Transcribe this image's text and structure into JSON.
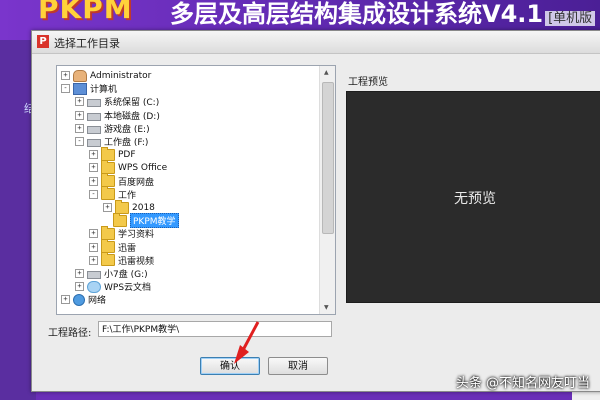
{
  "app": {
    "logo": "PKPM",
    "title": "多层及高层结构集成设计系统V4.1",
    "edition_tag": "[单机版"
  },
  "background": {
    "left_tab_text": "结"
  },
  "dialog": {
    "title": "选择工作目录",
    "preview_label": "工程预览",
    "preview_text": "无预览",
    "path_label": "工程路径:",
    "path_value": "F:\\工作\\PKPM教学\\",
    "ok_label": "确认",
    "cancel_label": "取消"
  },
  "tree": {
    "items": [
      {
        "label": "Administrator",
        "icon": "user-icon",
        "expander": "+"
      },
      {
        "label": "计算机",
        "icon": "computer-icon",
        "expander": "-"
      },
      {
        "label": "系统保留 (C:)",
        "icon": "drive-icon",
        "expander": "+"
      },
      {
        "label": "本地磁盘 (D:)",
        "icon": "drive-icon",
        "expander": "+"
      },
      {
        "label": "游戏盘 (E:)",
        "icon": "drive-icon",
        "expander": "+"
      },
      {
        "label": "工作盘 (F:)",
        "icon": "drive-icon",
        "expander": "-"
      },
      {
        "label": "PDF",
        "icon": "folder-icon",
        "expander": "+"
      },
      {
        "label": "WPS Office",
        "icon": "folder-icon",
        "expander": "+"
      },
      {
        "label": "百度网盘",
        "icon": "folder-icon",
        "expander": "+"
      },
      {
        "label": "工作",
        "icon": "folder-icon",
        "expander": "-"
      },
      {
        "label": "2018",
        "icon": "folder-icon",
        "expander": "+"
      },
      {
        "label": "PKPM教学",
        "icon": "folder-icon",
        "expander": "",
        "selected": true
      },
      {
        "label": "学习资料",
        "icon": "folder-icon",
        "expander": "+"
      },
      {
        "label": "迅雷",
        "icon": "folder-icon",
        "expander": "+"
      },
      {
        "label": "迅雷视频",
        "icon": "folder-icon",
        "expander": "+"
      },
      {
        "label": "小7盘 (G:)",
        "icon": "drive-icon",
        "expander": "+"
      },
      {
        "label": "WPS云文档",
        "icon": "cloud-icon",
        "expander": "+"
      },
      {
        "label": "网络",
        "icon": "network-icon",
        "expander": "+"
      }
    ]
  },
  "watermark": "头条 @不知名网友叮当",
  "colors": {
    "banner": "#6a2fb8",
    "preview_bg": "#2b2b2b",
    "selection": "#3399ff",
    "annotation": "#e02020"
  }
}
